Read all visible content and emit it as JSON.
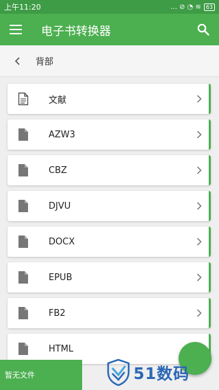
{
  "status_bar": {
    "time": "上午11:20",
    "icons": "... ⊘ ◔ ≋",
    "battery": "63"
  },
  "app_bar": {
    "title": "电子书转换器",
    "menu_icon": "menu-icon",
    "search_icon": "search-icon"
  },
  "breadcrumb": {
    "back_icon": "chevron-left-icon",
    "label": "背部"
  },
  "list": {
    "items": [
      {
        "label": "文献",
        "icon": "document-icon"
      },
      {
        "label": "AZW3",
        "icon": "file-icon"
      },
      {
        "label": "CBZ",
        "icon": "file-icon"
      },
      {
        "label": "DJVU",
        "icon": "file-icon"
      },
      {
        "label": "DOCX",
        "icon": "file-icon"
      },
      {
        "label": "EPUB",
        "icon": "file-icon"
      },
      {
        "label": "FB2",
        "icon": "file-icon"
      },
      {
        "label": "HTML",
        "icon": "file-icon"
      }
    ]
  },
  "bottom_bar": {
    "message": "暂无文件"
  },
  "watermark": {
    "text": "51数码"
  },
  "colors": {
    "primary": "#4caf50",
    "status_bar": "#3e9c46",
    "watermark": "#2a67b5"
  }
}
